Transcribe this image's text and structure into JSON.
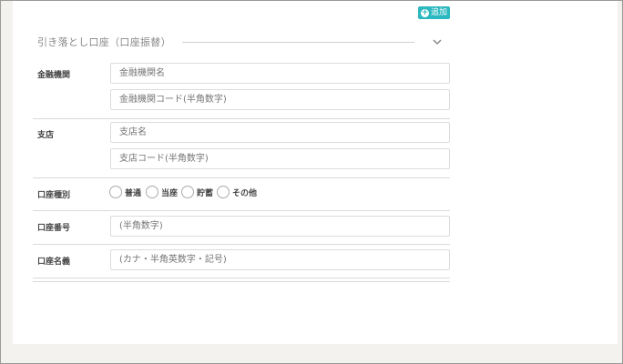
{
  "header": {
    "add_button_label": "追加",
    "section_title": "引き落とし口座（口座振替）"
  },
  "icons": {
    "add": "plus-circle-icon",
    "collapse": "chevron-down-icon"
  },
  "colors": {
    "accent": "#2bb8c0",
    "background": "#f3f2ef"
  },
  "form": {
    "bank": {
      "label": "金融機関",
      "name_placeholder": "金融機関名",
      "code_placeholder": "金融機関コード(半角数字)"
    },
    "branch": {
      "label": "支店",
      "name_placeholder": "支店名",
      "code_placeholder": "支店コード(半角数字)"
    },
    "account_type": {
      "label": "口座種別",
      "options": [
        "普通",
        "当座",
        "貯蓄",
        "その他"
      ]
    },
    "account_number": {
      "label": "口座番号",
      "placeholder": "(半角数字)"
    },
    "account_holder": {
      "label": "口座名義",
      "placeholder": "(カナ・半角英数字・記号)"
    }
  }
}
